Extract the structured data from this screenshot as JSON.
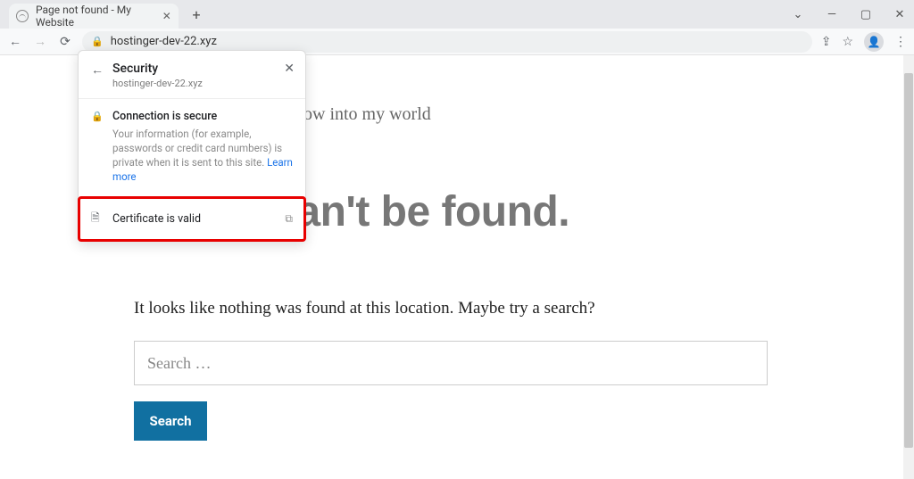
{
  "browser": {
    "tab_title": "Page not found - My Website",
    "url": "hostinger-dev-22.xyz"
  },
  "popover": {
    "title": "Security",
    "domain": "hostinger-dev-22.xyz",
    "conn_title": "Connection is secure",
    "conn_desc_prefix": "Your information (for example, passwords or credit card numbers) is private when it is sent to this site. ",
    "learn_more": "Learn more",
    "cert_label": "Certificate is valid"
  },
  "page": {
    "tagline": "ow into my world",
    "headline": "t page can't be found.",
    "subtext": "It looks like nothing was found at this location. Maybe try a search?",
    "search_placeholder": "Search …",
    "search_button": "Search"
  }
}
